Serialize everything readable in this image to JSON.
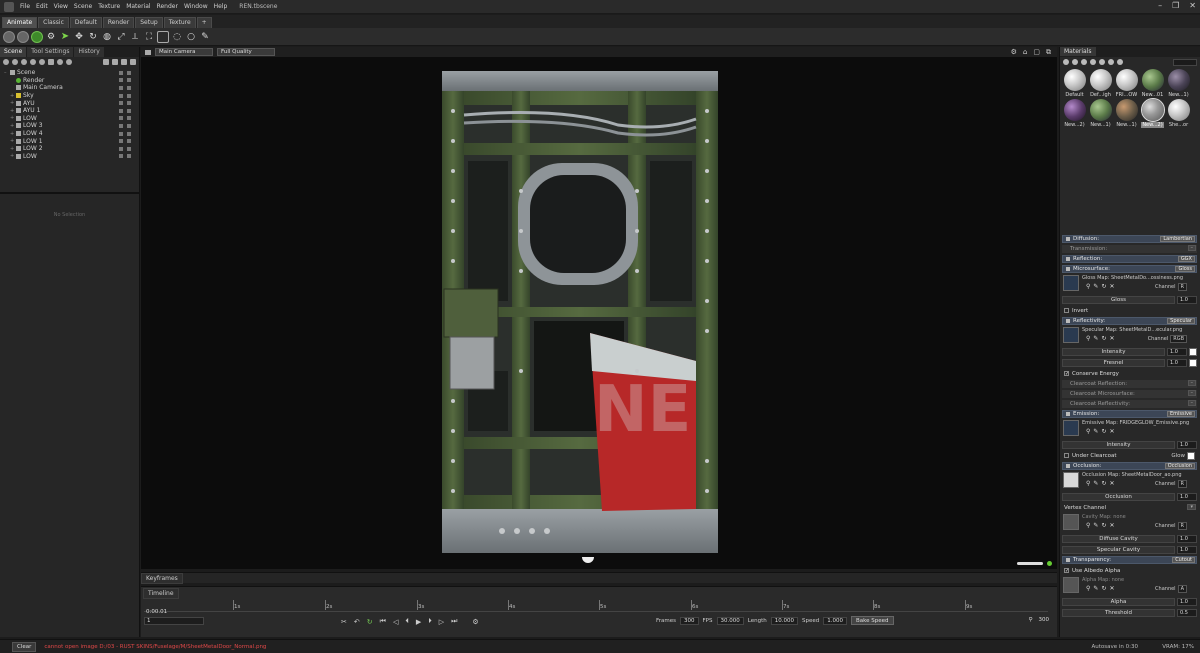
{
  "menubar": {
    "items": [
      "File",
      "Edit",
      "View",
      "Scene",
      "Texture",
      "Material",
      "Render",
      "Window",
      "Help"
    ],
    "file_title": "REN.tbscene"
  },
  "tabs": [
    "Animate",
    "Classic",
    "Default",
    "Render",
    "Setup",
    "Texture",
    "+"
  ],
  "left_panel": {
    "tabs": [
      "Scene",
      "Tool Settings",
      "History"
    ],
    "tree": [
      {
        "label": "Scene",
        "icon": "scene-icon",
        "exp": "–"
      },
      {
        "label": "Render",
        "icon": "render-icon",
        "exp": ""
      },
      {
        "label": "Main Camera",
        "icon": "camera-icon",
        "exp": ""
      },
      {
        "label": "Sky",
        "icon": "sky-icon",
        "exp": "+"
      },
      {
        "label": "AYU",
        "icon": "mesh-icon",
        "exp": "+"
      },
      {
        "label": "AYU 1",
        "icon": "mesh-icon",
        "exp": "+"
      },
      {
        "label": "LOW",
        "icon": "mesh-icon",
        "exp": "+"
      },
      {
        "label": "LOW 3",
        "icon": "mesh-icon",
        "exp": "+"
      },
      {
        "label": "LOW 4",
        "icon": "mesh-icon",
        "exp": "+"
      },
      {
        "label": "LOW 1",
        "icon": "mesh-icon",
        "exp": "+"
      },
      {
        "label": "LOW 2",
        "icon": "mesh-icon",
        "exp": "+"
      },
      {
        "label": "LOW",
        "icon": "mesh-icon",
        "exp": "+"
      }
    ],
    "no_selection": "No Selection"
  },
  "viewport": {
    "camera": "Main Camera",
    "quality": "Full Quality"
  },
  "keyframes_tab": "Keyframes",
  "timeline": {
    "tab": "Timeline",
    "current_time": "0:00.01",
    "frame_value": "1",
    "ruler_labels": [
      "1s",
      "2s",
      "3s",
      "4s",
      "5s",
      "6s",
      "7s",
      "8s",
      "9s"
    ],
    "frames_label": "Frames",
    "frames_value": "300",
    "fps_label": "FPS",
    "fps_value": "30.000",
    "length_label": "Length",
    "length_value": "10.000",
    "speed_label": "Speed",
    "speed_value": "1.000",
    "bake_speed": "Bake Speed",
    "end_frame": "300"
  },
  "status": {
    "clear": "Clear",
    "error": "cannot open image D:/03 - RUST SKINS/Fuselage/M/SheetMetalDoor_Normal.png",
    "autosave": "Autosave in 0:30",
    "vram": "VRAM: 17%"
  },
  "materials": {
    "tab": "Materials",
    "items": [
      {
        "label": "Default",
        "style": "white"
      },
      {
        "label": "Def...igh",
        "style": "white"
      },
      {
        "label": "FRI...OW",
        "style": "white"
      },
      {
        "label": "New...01",
        "style": "green"
      },
      {
        "label": "New...1)",
        "style": "dark"
      },
      {
        "label": "New...2)",
        "style": "purple"
      },
      {
        "label": "New...1)",
        "style": "green"
      },
      {
        "label": "New...1)",
        "style": "rust"
      },
      {
        "label": "New...2)",
        "style": "metal",
        "selected": true
      },
      {
        "label": "She...or",
        "style": "white"
      }
    ]
  },
  "props": {
    "diffusion": {
      "label": "Diffusion:",
      "mode": "Lambertian"
    },
    "transmission": {
      "label": "Transmission:",
      "mode": "–"
    },
    "reflection": {
      "label": "Reflection:",
      "mode": "GGX"
    },
    "microsurface": {
      "label": "Microsurface:",
      "mode": "Gloss"
    },
    "gloss_map": "Gloss Map: SheetMetalDo...ossiness.png",
    "gloss_channel": "R",
    "gloss_label": "Gloss",
    "gloss_value": "1.0",
    "invert": "Invert",
    "reflectivity": {
      "label": "Reflectivity:",
      "mode": "Specular"
    },
    "specular_map": "Specular Map: SheetMetalD...ecular.png",
    "specular_channel": "RGB",
    "intensity_label": "Intensity",
    "intensity_value": "1.0",
    "fresnel_label": "Fresnel",
    "fresnel_value": "1.0",
    "conserve_energy": "Conserve Energy",
    "clearcoat_reflection": "Clearcoat Reflection:",
    "clearcoat_microsurface": "Clearcoat Microsurface:",
    "clearcoat_reflectivity": "Clearcoat Reflectivity:",
    "emission": {
      "label": "Emission:",
      "mode": "Emissive"
    },
    "emissive_map": "Emissive Map: FRIDGEGLOW_Emissive.png",
    "em_intensity_label": "Intensity",
    "em_intensity_value": "1.0",
    "under_clearcoat": "Under Clearcoat",
    "glow": "Glow",
    "occlusion": {
      "label": "Occlusion:",
      "mode": "Occlusion"
    },
    "occlusion_map": "Occlusion Map: SheetMetalDoor_ao.png",
    "occlusion_channel": "R",
    "occlusion_label": "Occlusion",
    "occlusion_value": "1.0",
    "vertex_channel": "Vertex Channel",
    "cavity_map": "Cavity Map: none",
    "cavity_channel": "R",
    "diffuse_cavity_label": "Diffuse Cavity",
    "diffuse_cavity_value": "1.0",
    "specular_cavity_label": "Specular Cavity",
    "specular_cavity_value": "1.0",
    "transparency": {
      "label": "Transparency:",
      "mode": "Cutout"
    },
    "use_albedo_alpha": "Use Albedo Alpha",
    "alpha_map": "Alpha Map: none",
    "alpha_channel": "A",
    "alpha_label": "Alpha",
    "alpha_value": "1.0",
    "threshold_label": "Threshold",
    "threshold_value": "0.5",
    "channel_label": "Channel"
  },
  "colors": {
    "accent_green": "#6fc050",
    "section_header": "#3c4656",
    "error_text": "#e04848",
    "door_olive": "#4a5a38",
    "door_red": "#c02828"
  }
}
